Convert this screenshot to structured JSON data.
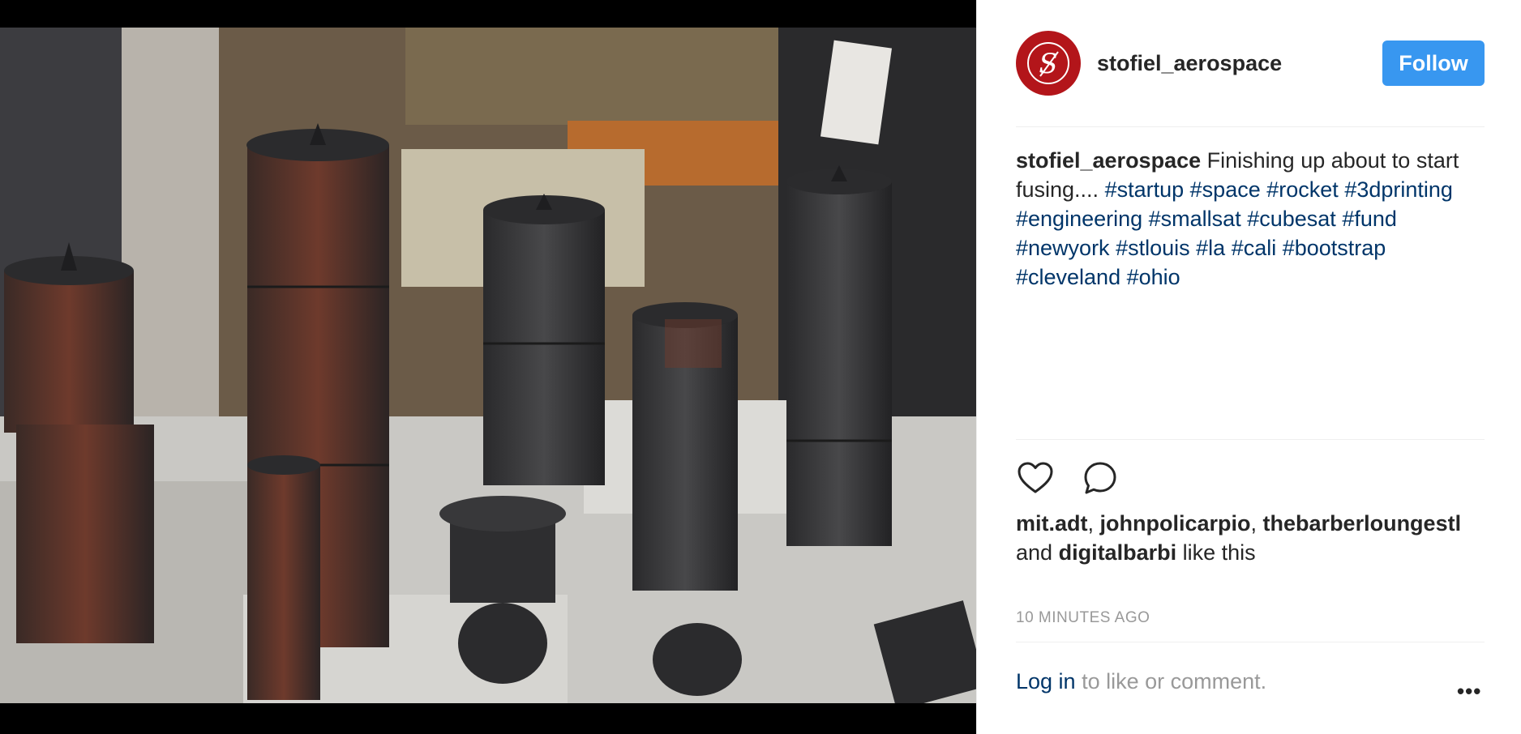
{
  "post": {
    "username": "stofiel_aerospace",
    "follow_label": "Follow",
    "caption_author": "stofiel_aerospace",
    "caption_text": "Finishing up about to start fusing....",
    "hashtags": [
      "#startup",
      "#space",
      "#rocket",
      "#3dprinting",
      "#engineering",
      "#smallsat",
      "#cubesat",
      "#fund",
      "#newyork",
      "#stlouis",
      "#la",
      "#cali",
      "#bootstrap",
      "#cleveland",
      "#ohio"
    ],
    "likers": [
      "mit.adt",
      "johnpolicarpio",
      "thebarberloungestl",
      "digitalbarbi"
    ],
    "likes_and": "and",
    "likes_suffix": "like this",
    "timestamp": "10 MINUTES AGO",
    "login_link": "Log in",
    "login_text": "to like or comment.",
    "more_label": "•••"
  },
  "icons": {
    "heart": "heart-icon",
    "comment": "comment-icon",
    "avatar_logo": "stofiel-logo"
  },
  "colors": {
    "follow_button": "#3897f0",
    "hashtag": "#003569",
    "avatar": "#b3151a",
    "muted_text": "#999999"
  }
}
